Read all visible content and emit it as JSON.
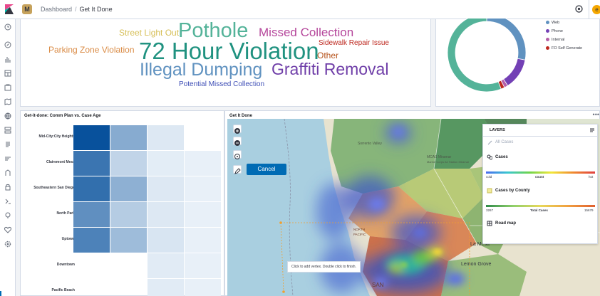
{
  "header": {
    "breadcrumb_root": "Dashboard",
    "breadcrumb_current": "Get It Done",
    "logo_initial": "M",
    "user_initial": "e"
  },
  "word_cloud": {
    "words": [
      {
        "text": "Street Light Out",
        "color": "#d6bf57"
      },
      {
        "text": "Pothole",
        "color": "#54b399"
      },
      {
        "text": "Missed Collection",
        "color": "#b5469b"
      },
      {
        "text": "Parking Zone Violation",
        "color": "#da8b45"
      },
      {
        "text": "72 Hour Violation",
        "color": "#209280"
      },
      {
        "text": "Sidewalk Repair Issue",
        "color": "#bd271e"
      },
      {
        "text": "Other",
        "color": "#b6531c"
      },
      {
        "text": "Illegal Dumping",
        "color": "#6092c0"
      },
      {
        "text": "Graffiti Removal",
        "color": "#6f3ea8"
      },
      {
        "text": "Potential Missed Collection",
        "color": "#3f4fb6"
      }
    ]
  },
  "donut": {
    "legend": [
      {
        "label": "Web",
        "color": "#6092c0"
      },
      {
        "label": "Phone",
        "color": "#7340b5"
      },
      {
        "label": "Internal",
        "color": "#b45fa8"
      },
      {
        "label": "FO Self Generate",
        "color": "#bd271e"
      }
    ],
    "segments": [
      {
        "label": "Web",
        "value": 28,
        "color": "#6092c0"
      },
      {
        "label": "Phone",
        "value": 13,
        "color": "#7340b5"
      },
      {
        "label": "Internal",
        "value": 1.5,
        "color": "#b45fa8"
      },
      {
        "label": "FO Self Generate",
        "value": 1.5,
        "color": "#bd271e"
      },
      {
        "value": 56,
        "color": "#54b399"
      }
    ]
  },
  "heatmap": {
    "title": "Get-it-done: Comm Plan vs. Case Age",
    "rows": [
      "Mid-City:City Heights",
      "Clairemont Mesa",
      "Southeastern San Diego",
      "North Park",
      "Uptown",
      "Downtown",
      "Pacific Beach"
    ],
    "intensities": [
      [
        1.0,
        0.45,
        0.08,
        0.0
      ],
      [
        0.78,
        0.2,
        0.05,
        0.03
      ],
      [
        0.82,
        0.42,
        0.08,
        0.03
      ],
      [
        0.62,
        0.25,
        0.08,
        0.03
      ],
      [
        0.7,
        0.35,
        0.1,
        0.03
      ],
      [
        0.0,
        0.0,
        0.06,
        0.03
      ],
      [
        0.0,
        0.0,
        0.06,
        0.03
      ]
    ]
  },
  "map": {
    "title": "Get It Done",
    "cancel_label": "Cancel",
    "tooltip": "Click to add vertex. Double click to finish.",
    "place_labels": [
      "Sorrento Valley",
      "MCAS Miramar",
      "Marine Corps Air Station Miramar",
      "La Mesa",
      "Lemon Grove",
      "SAN",
      "NORTH",
      "PACIFIC"
    ],
    "layers": {
      "title": "LAYERS",
      "all_cases": "All Cases",
      "cases": "Cases",
      "cases_legend": {
        "min": "cold",
        "mid": "count",
        "max": "hot"
      },
      "cases_by_county": "Cases by County",
      "county_legend": {
        "min": "3267",
        "mid": "Total Cases",
        "max": "15679"
      },
      "road_map": "Road map"
    }
  }
}
